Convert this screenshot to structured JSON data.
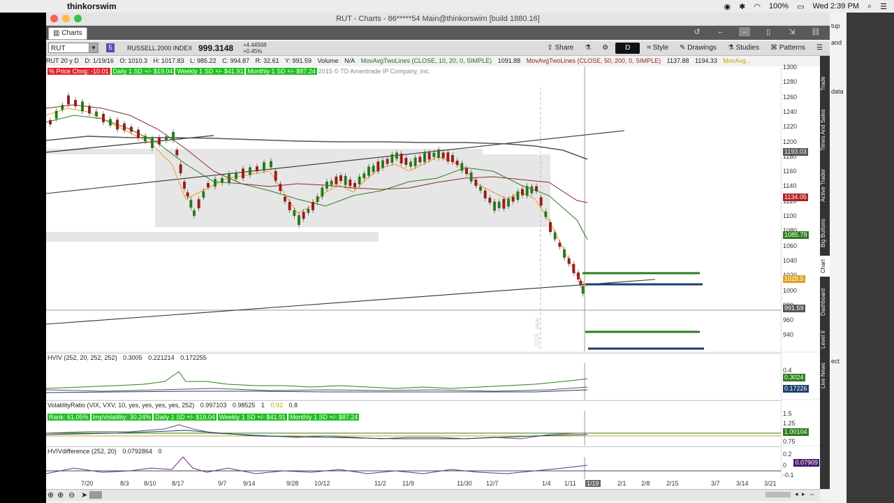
{
  "menubar": {
    "app_name": "thinkorswim",
    "battery": "100%",
    "clock": "Wed 2:39 PM"
  },
  "window": {
    "title": "RUT - Charts - 86*****54 Main@thinkorswim [build 1880.16]",
    "traffic_colors": [
      "#fc605c",
      "#fdbc40",
      "#34c749"
    ]
  },
  "toolbar1": {
    "charts_tab": "Charts"
  },
  "toolbar2": {
    "symbol": "RUT",
    "badge": "5",
    "index_name": "RUSSELL 2000 INDEX",
    "last": "999.3148",
    "net_change": "+4.44568",
    "pct_change": "+0.45%",
    "share": "Share",
    "timeframe": "D",
    "style": "Style",
    "drawings": "Drawings",
    "studies": "Studies",
    "patterns": "Patterns"
  },
  "study_row": {
    "period": "RUT 20 y D",
    "date": "D: 1/19/16",
    "open": "O: 1010.3",
    "high": "H: 1017.83",
    "low": "L: 985.22",
    "close": "C: 994.87",
    "range": "R: 32.61",
    "y": "Y: 991.59",
    "volume": "Volume",
    "volume_val": "N/A",
    "ma1": "MovAvgTwoLines (CLOSE, 10, 20, 0, SIMPLE)",
    "ma1_val": "1091.88",
    "ma2": "MovAvgTwoLines (CLOSE, 50, 200, 0, SIMPLE)",
    "ma2_val1": "1137.88",
    "ma2_val2": "1194.33",
    "ma3": "MovAvg..."
  },
  "chart_labels": {
    "price_chng": "% Price Chng: -10.01",
    "daily_sd": "Daily 1 SD +/- $19.04",
    "weekly_sd": "Weekly 1 SD +/- $41.91",
    "monthly_sd": "Monthly 1 SD +/- $87.24",
    "copyright": "2015 © TD Ameritrade IP Company, Inc.",
    "year_marker": "2015_year"
  },
  "price_axis": {
    "ticks": [
      "1300",
      "1280",
      "1260",
      "1240",
      "1220",
      "1200",
      "1180",
      "1160",
      "1140",
      "1120",
      "1100",
      "1080",
      "1060",
      "1040",
      "1020",
      "1000",
      "980",
      "960",
      "940"
    ],
    "tags": [
      {
        "text": "1193.03",
        "color": "#555555"
      },
      {
        "text": "1134.05",
        "color": "#b02020"
      },
      {
        "text": "1085.79",
        "color": "#2d7d1f"
      },
      {
        "text": "1029.5",
        "color": "#e0a020"
      },
      {
        "text": "991.59",
        "color": "#555555"
      }
    ]
  },
  "hviv_panel": {
    "title": "HVIV (252, 20, 252, 252)",
    "v1": "0.3005",
    "v2": "0.221214",
    "v3": "0.172255",
    "axis_label": "0.4",
    "tag1": "0.3024",
    "tag2": "0.17226"
  },
  "vol_panel": {
    "title": "VolatilityRatio (VIX, VXV, 10, yes, yes, yes, yes, 252)",
    "v1": "0.997103",
    "v2": "0.98525",
    "v3": "1",
    "v4": "0.92",
    "v5": "0.8",
    "rank": "Rank: 61.05%",
    "impvol": "ImpVolatility: 30.24%",
    "daily_sd": "Daily 1 SD +/- $19.04",
    "weekly_sd": "Weekly 1 SD +/- $41.91",
    "monthly_sd": "Monthly 1 SD +/- $87.24",
    "ticks": [
      "1.5",
      "1.25",
      "0.75"
    ],
    "tag": "1.00104"
  },
  "diff_panel": {
    "title": "HVIVdifference (252, 20)",
    "v1": "0.0792864",
    "v2": "0",
    "ticks": [
      "0.2",
      "0",
      "-0.1"
    ],
    "tag": "0.07909"
  },
  "xaxis": {
    "labels": [
      "7/20",
      "8/3",
      "8/10",
      "8/17",
      "9/7",
      "9/14",
      "9/28",
      "10/12",
      "11/2",
      "11/9",
      "11/30",
      "12/7",
      "1/4",
      "1/11",
      "1/19",
      "2/1",
      "2/8",
      "2/15",
      "3/7",
      "3/14",
      "3/21"
    ]
  },
  "sidetabs": [
    "Trade",
    "Times And Sales",
    "Active Trader",
    "Big Buttons",
    "Chart",
    "Dashboard",
    "Level II",
    "Live News"
  ],
  "right_peek": [
    "tup",
    "and",
    "data",
    "ect"
  ]
}
